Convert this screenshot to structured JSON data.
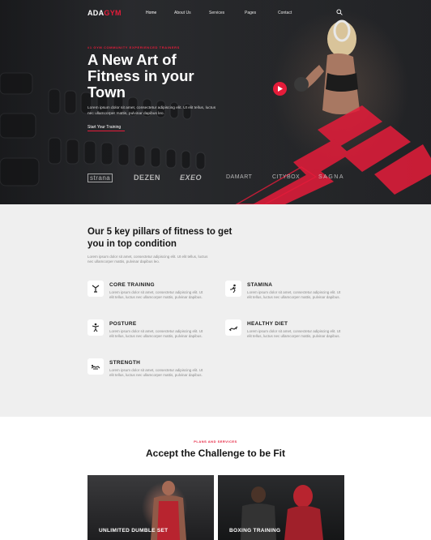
{
  "nav": {
    "logo_part1": "ADA",
    "logo_part2": "GYM",
    "links": [
      "Home",
      "About Us",
      "Services",
      "Pages",
      "Contact"
    ],
    "search_icon": "search-icon"
  },
  "hero": {
    "tagline": "#1 Gym Community Experienced Trainers",
    "title": "A New Art of Fitness in your Town",
    "description": "Lorem ipsum dolor sit amet, consectetur adipiscing elit. Ut elit tellus, luctus nec ullamcorper mattis, pulvinar dapibus leo.",
    "cta": "Start Your Training",
    "play_icon": "play-icon",
    "brands": [
      "strana",
      "DEZEN",
      "EXEO",
      "DAMART",
      "CITYBOX",
      "SAGNA"
    ]
  },
  "pillars": {
    "title": "Our 5 key pillars of fitness to get you in top condition",
    "description": "Lorem ipsum dolor sit amet, consectetur adipiscing elit. Ut elit tellus, luctus nec ullamcorper mattis, pulvinar dapibus leo.",
    "items": [
      {
        "title": "CORE TRAINING",
        "icon": "core-training-icon",
        "desc": "Lorem ipsum dolor sit amet, consectetur adipiscing elit. Ut elit tellus, luctus nec ullamcorper mattis, pulvinar dapibus."
      },
      {
        "title": "STAMINA",
        "icon": "stamina-icon",
        "desc": "Lorem ipsum dolor sit amet, consectetur adipiscing elit. Ut elit tellus, luctus nec ullamcorper mattis, pulvinar dapibus."
      },
      {
        "title": "POSTURE",
        "icon": "posture-icon",
        "desc": "Lorem ipsum dolor sit amet, consectetur adipiscing elit. Ut elit tellus, luctus nec ullamcorper mattis, pulvinar dapibus."
      },
      {
        "title": "HEALTHY DIET",
        "icon": "healthy-diet-icon",
        "desc": "Lorem ipsum dolor sit amet, consectetur adipiscing elit. Ut elit tellus, luctus nec ullamcorper mattis, pulvinar dapibus."
      },
      {
        "title": "STRENGTH",
        "icon": "strength-icon",
        "desc": "Lorem ipsum dolor sit amet, consectetur adipiscing elit. Ut elit tellus, luctus nec ullamcorper mattis, pulvinar dapibus."
      }
    ]
  },
  "plans": {
    "tag": "Plans and Services",
    "title": "Accept the Challenge to be Fit",
    "cards": [
      {
        "label": "UNLIMITED DUMBLE SET"
      },
      {
        "label": "BOXING TRAINING"
      }
    ]
  },
  "colors": {
    "accent": "#e51c3a",
    "hero_dark": "#2b2d31",
    "section_bg": "#efefef"
  }
}
